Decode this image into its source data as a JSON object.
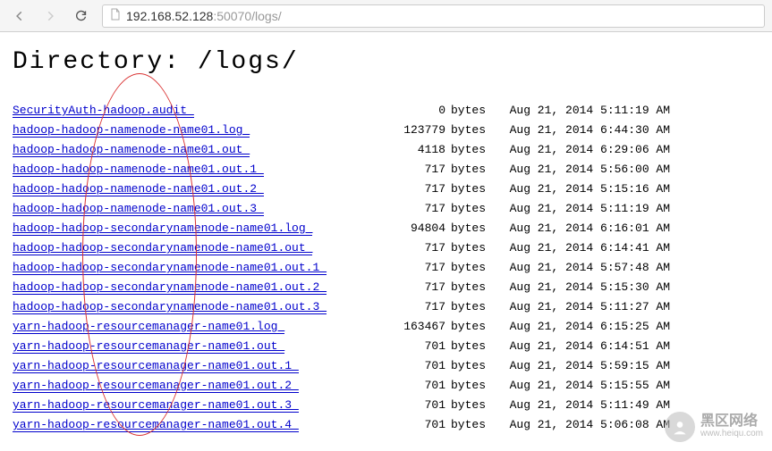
{
  "browser": {
    "url_host": "192.168.52.128",
    "url_port_path": ":50070/logs/"
  },
  "page": {
    "heading": "Directory: /logs/"
  },
  "listing": [
    {
      "name": "SecurityAuth-hadoop.audit",
      "size": "0",
      "unit": "bytes",
      "date": "Aug 21, 2014 5:11:19 AM"
    },
    {
      "name": "hadoop-hadoop-namenode-name01.log",
      "size": "123779",
      "unit": "bytes",
      "date": "Aug 21, 2014 6:44:30 AM"
    },
    {
      "name": "hadoop-hadoop-namenode-name01.out",
      "size": "4118",
      "unit": "bytes",
      "date": "Aug 21, 2014 6:29:06 AM"
    },
    {
      "name": "hadoop-hadoop-namenode-name01.out.1",
      "size": "717",
      "unit": "bytes",
      "date": "Aug 21, 2014 5:56:00 AM"
    },
    {
      "name": "hadoop-hadoop-namenode-name01.out.2",
      "size": "717",
      "unit": "bytes",
      "date": "Aug 21, 2014 5:15:16 AM"
    },
    {
      "name": "hadoop-hadoop-namenode-name01.out.3",
      "size": "717",
      "unit": "bytes",
      "date": "Aug 21, 2014 5:11:19 AM"
    },
    {
      "name": "hadoop-hadoop-secondarynamenode-name01.log",
      "size": "94804",
      "unit": "bytes",
      "date": "Aug 21, 2014 6:16:01 AM"
    },
    {
      "name": "hadoop-hadoop-secondarynamenode-name01.out",
      "size": "717",
      "unit": "bytes",
      "date": "Aug 21, 2014 6:14:41 AM"
    },
    {
      "name": "hadoop-hadoop-secondarynamenode-name01.out.1",
      "size": "717",
      "unit": "bytes",
      "date": "Aug 21, 2014 5:57:48 AM"
    },
    {
      "name": "hadoop-hadoop-secondarynamenode-name01.out.2",
      "size": "717",
      "unit": "bytes",
      "date": "Aug 21, 2014 5:15:30 AM"
    },
    {
      "name": "hadoop-hadoop-secondarynamenode-name01.out.3",
      "size": "717",
      "unit": "bytes",
      "date": "Aug 21, 2014 5:11:27 AM"
    },
    {
      "name": "yarn-hadoop-resourcemanager-name01.log",
      "size": "163467",
      "unit": "bytes",
      "date": "Aug 21, 2014 6:15:25 AM"
    },
    {
      "name": "yarn-hadoop-resourcemanager-name01.out",
      "size": "701",
      "unit": "bytes",
      "date": "Aug 21, 2014 6:14:51 AM"
    },
    {
      "name": "yarn-hadoop-resourcemanager-name01.out.1",
      "size": "701",
      "unit": "bytes",
      "date": "Aug 21, 2014 5:59:15 AM"
    },
    {
      "name": "yarn-hadoop-resourcemanager-name01.out.2",
      "size": "701",
      "unit": "bytes",
      "date": "Aug 21, 2014 5:15:55 AM"
    },
    {
      "name": "yarn-hadoop-resourcemanager-name01.out.3",
      "size": "701",
      "unit": "bytes",
      "date": "Aug 21, 2014 5:11:49 AM"
    },
    {
      "name": "yarn-hadoop-resourcemanager-name01.out.4",
      "size": "701",
      "unit": "bytes",
      "date": "Aug 21, 2014 5:06:08 AM"
    }
  ],
  "watermark": {
    "top": "黑区网络",
    "bottom": "www.heiqu.com"
  }
}
